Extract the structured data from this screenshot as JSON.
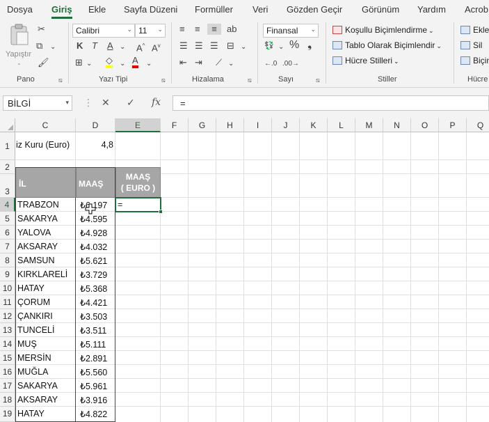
{
  "menu": {
    "tabs": [
      "Dosya",
      "Giriş",
      "Ekle",
      "Sayfa Düzeni",
      "Formüller",
      "Veri",
      "Gözden Geçir",
      "Görünüm",
      "Yardım",
      "Acrob"
    ],
    "active": "Giriş"
  },
  "ribbon": {
    "paste_label": "Yapıştır",
    "font_name": "Calibri",
    "font_size": "11",
    "bold": "K",
    "italic": "T",
    "underline": "A",
    "grow_font": "A",
    "shrink_font": "A",
    "number_format": "Finansal",
    "percent": "%",
    "comma": "❟",
    "styles": {
      "conditional": "Koşullu Biçimlendirme",
      "table": "Tablo Olarak Biçimlendir",
      "cell_styles": "Hücre Stilleri"
    },
    "cells": {
      "insert": "Ekle",
      "delete": "Sil",
      "format": "Biçim"
    },
    "groups": {
      "clipboard": "Pano",
      "font": "Yazı Tipi",
      "alignment": "Hizalama",
      "number": "Sayı",
      "styles": "Stiller",
      "cells": "Hücre"
    }
  },
  "formula_bar": {
    "name_box": "BİLGİ",
    "formula": "="
  },
  "grid": {
    "columns": [
      "C",
      "D",
      "E",
      "F",
      "G",
      "H",
      "I",
      "J",
      "K",
      "L",
      "M",
      "N",
      "O",
      "P",
      "Q"
    ],
    "selected_column": "E",
    "rows": [
      "1",
      "2",
      "3",
      "4",
      "5",
      "6",
      "7",
      "8",
      "9",
      "10",
      "11",
      "12",
      "13",
      "14",
      "15",
      "16",
      "17",
      "18",
      "19"
    ],
    "selected_row": "4",
    "rate_label": "iz Kuru (Euro)",
    "rate_value": "4,8",
    "header_il": "İL",
    "header_maas": "MAAŞ",
    "header_maas_euro_1": "MAAŞ",
    "header_maas_euro_2": "( EURO )",
    "active_cell_value": "=",
    "data": [
      {
        "il": "TRABZON",
        "maas": "₺6.197"
      },
      {
        "il": "SAKARYA",
        "maas": "₺4.595"
      },
      {
        "il": "YALOVA",
        "maas": "₺4.928"
      },
      {
        "il": "AKSARAY",
        "maas": "₺4.032"
      },
      {
        "il": "SAMSUN",
        "maas": "₺5.621"
      },
      {
        "il": "KIRKLARELİ",
        "maas": "₺3.729"
      },
      {
        "il": "HATAY",
        "maas": "₺5.368"
      },
      {
        "il": "ÇORUM",
        "maas": "₺4.421"
      },
      {
        "il": "ÇANKIRI",
        "maas": "₺3.503"
      },
      {
        "il": "TUNCELİ",
        "maas": "₺3.511"
      },
      {
        "il": "MUŞ",
        "maas": "₺5.111"
      },
      {
        "il": "MERSİN",
        "maas": "₺2.891"
      },
      {
        "il": "MUĞLA",
        "maas": "₺5.560"
      },
      {
        "il": "SAKARYA",
        "maas": "₺5.961"
      },
      {
        "il": "AKSARAY",
        "maas": "₺3.916"
      },
      {
        "il": "HATAY",
        "maas": "₺4.822"
      }
    ]
  },
  "colors": {
    "accent": "#1e6e3c",
    "header_fill": "#a6a6a6"
  }
}
